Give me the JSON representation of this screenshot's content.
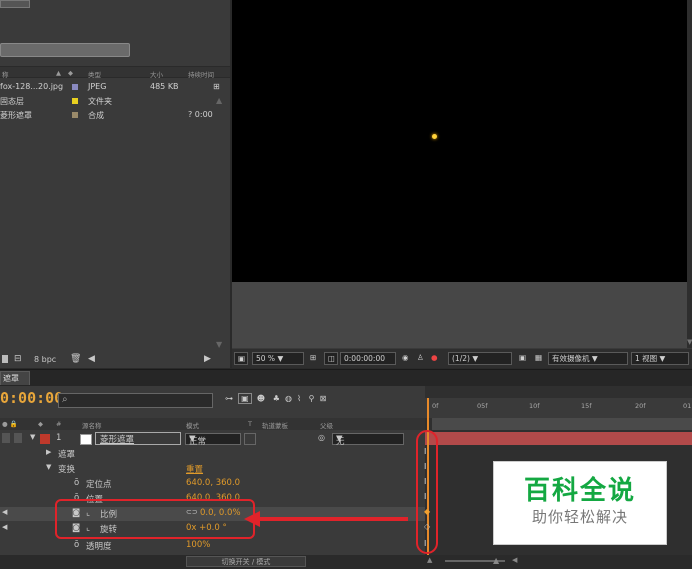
{
  "project": {
    "headers": {
      "name": "称",
      "type": "类型",
      "size": "大小",
      "duration": "持续时间"
    },
    "rows": [
      {
        "name": "fox-128...20.jpg",
        "color": "#8a8ac0",
        "type": "JPEG",
        "size": "485 KB",
        "duration": ""
      },
      {
        "name": "固态层",
        "color": "#e8d020",
        "type": "文件夹",
        "size": "",
        "duration": ""
      },
      {
        "name": "菱形遮罩",
        "color": "#9a8a6a",
        "type": "合成",
        "size": "",
        "duration": "? 0:00"
      }
    ],
    "footer_bpc": "8 bpc"
  },
  "viewer": {
    "zoom": "50 %",
    "timecode": "0:00:00:00",
    "resolution": "(1/2)",
    "camera": "有效摄像机",
    "views": "1 视图"
  },
  "timeline": {
    "tab_label": "遮罩",
    "current_time": "0:00:00",
    "columns": {
      "num": "#",
      "source": "源名称",
      "mode": "模式",
      "t": "T",
      "trkmat": "轨道蒙板",
      "parent": "父级"
    },
    "layer": {
      "index": "1",
      "name": "菱形遮罩",
      "mode": "正常",
      "parent": "无"
    },
    "groups": {
      "masks": "遮罩",
      "transform": "变换",
      "reset": "重置"
    },
    "props": [
      {
        "name": "定位点",
        "value": "640.0, 360.0"
      },
      {
        "name": "位置",
        "value": "640.0, 360.0"
      },
      {
        "name": "比例",
        "value": "0.0, 0.0%"
      },
      {
        "name": "旋转",
        "value": "0x +0.0 °"
      },
      {
        "name": "透明度",
        "value": "100%"
      }
    ],
    "ruler": [
      "0f",
      "05f",
      "10f",
      "15f",
      "20f",
      "01"
    ],
    "bottom_label": "切换开关 / 模式"
  },
  "watermark": {
    "title": "百科全说",
    "subtitle": "助你轻松解决"
  },
  "colors": {
    "accent": "#e09a2a",
    "callout": "#e0232a",
    "brand": "#14a842",
    "layer_bar": "#b24a4a"
  }
}
